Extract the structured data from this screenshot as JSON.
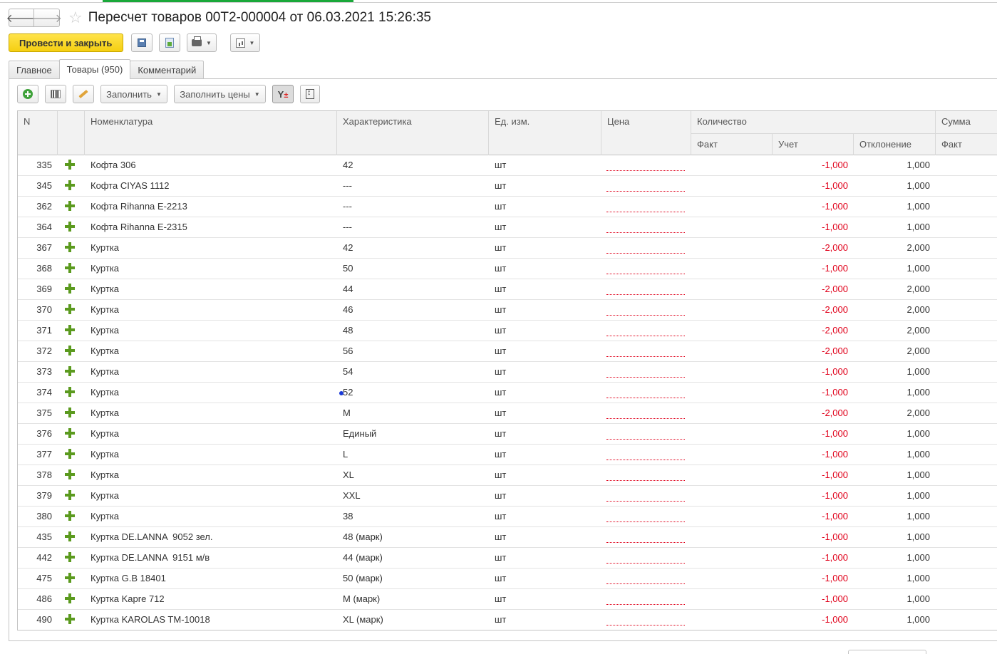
{
  "window": {
    "title": "Пересчет товаров 00Т2-000004 от 06.03.2021 15:26:35",
    "back_glyph": "🡐",
    "forward_glyph": "🡒",
    "star_glyph": "☆"
  },
  "toolbar": {
    "post_and_close": "Провести и закрыть",
    "save_icon": "floppy-icon",
    "post_icon": "document-post-icon",
    "print_icon": "printer-icon",
    "reports_icon": "report-icon"
  },
  "tabs": [
    {
      "label": "Главное",
      "active": false
    },
    {
      "label": "Товары (950)",
      "active": true
    },
    {
      "label": "Комментарий",
      "active": false
    }
  ],
  "grid_toolbar": {
    "fill_label": "Заполнить",
    "fill_prices_label": "Заполнить цены",
    "filter_glyph": "Y",
    "filter_sign": "±"
  },
  "columns": {
    "n": "N",
    "nomenclature": "Номенклатура",
    "characteristic": "Характеристика",
    "unit": "Ед. изм.",
    "price": "Цена",
    "quantity": "Количество",
    "quantity_fact": "Факт",
    "quantity_account": "Учет",
    "quantity_deviation": "Отклонение",
    "sum": "Сумма",
    "sum_fact": "Факт"
  },
  "rows": [
    {
      "n": "335",
      "name": "Кофта 306",
      "char": "42",
      "unit": "шт",
      "deviation": "-1,000",
      "account": "1,000"
    },
    {
      "n": "345",
      "name": "Кофта CIYAS 1112",
      "char": "---",
      "unit": "шт",
      "deviation": "-1,000",
      "account": "1,000"
    },
    {
      "n": "362",
      "name": "Кофта Rihanna E-2213",
      "char": "---",
      "unit": "шт",
      "deviation": "-1,000",
      "account": "1,000"
    },
    {
      "n": "364",
      "name": "Кофта Rihanna E-2315",
      "char": "---",
      "unit": "шт",
      "deviation": "-1,000",
      "account": "1,000"
    },
    {
      "n": "367",
      "name": "Куртка",
      "char": "42",
      "unit": "шт",
      "deviation": "-2,000",
      "account": "2,000"
    },
    {
      "n": "368",
      "name": "Куртка",
      "char": "50",
      "unit": "шт",
      "deviation": "-1,000",
      "account": "1,000"
    },
    {
      "n": "369",
      "name": "Куртка",
      "char": "44",
      "unit": "шт",
      "deviation": "-2,000",
      "account": "2,000"
    },
    {
      "n": "370",
      "name": "Куртка",
      "char": "46",
      "unit": "шт",
      "deviation": "-2,000",
      "account": "2,000"
    },
    {
      "n": "371",
      "name": "Куртка",
      "char": "48",
      "unit": "шт",
      "deviation": "-2,000",
      "account": "2,000"
    },
    {
      "n": "372",
      "name": "Куртка",
      "char": "56",
      "unit": "шт",
      "deviation": "-2,000",
      "account": "2,000"
    },
    {
      "n": "373",
      "name": "Куртка",
      "char": "54",
      "unit": "шт",
      "deviation": "-1,000",
      "account": "1,000"
    },
    {
      "n": "374",
      "name": "Куртка",
      "char": "52",
      "unit": "шт",
      "deviation": "-1,000",
      "account": "1,000"
    },
    {
      "n": "375",
      "name": "Куртка",
      "char": "M",
      "unit": "шт",
      "deviation": "-2,000",
      "account": "2,000"
    },
    {
      "n": "376",
      "name": "Куртка",
      "char": "Единый",
      "unit": "шт",
      "deviation": "-1,000",
      "account": "1,000"
    },
    {
      "n": "377",
      "name": "Куртка",
      "char": "L",
      "unit": "шт",
      "deviation": "-1,000",
      "account": "1,000"
    },
    {
      "n": "378",
      "name": "Куртка",
      "char": "XL",
      "unit": "шт",
      "deviation": "-1,000",
      "account": "1,000"
    },
    {
      "n": "379",
      "name": "Куртка",
      "char": "XXL",
      "unit": "шт",
      "deviation": "-1,000",
      "account": "1,000"
    },
    {
      "n": "380",
      "name": "Куртка",
      "char": "38",
      "unit": "шт",
      "deviation": "-1,000",
      "account": "1,000"
    },
    {
      "n": "435",
      "name": "Куртка DE.LANNA  9052 зел.",
      "char": "48 (марк)",
      "unit": "шт",
      "deviation": "-1,000",
      "account": "1,000"
    },
    {
      "n": "442",
      "name": "Куртка DE.LANNA  9151 м/в",
      "char": "44 (марк)",
      "unit": "шт",
      "deviation": "-1,000",
      "account": "1,000"
    },
    {
      "n": "475",
      "name": "Куртка G.B 18401",
      "char": "50 (марк)",
      "unit": "шт",
      "deviation": "-1,000",
      "account": "1,000"
    },
    {
      "n": "486",
      "name": "Куртка Kapre 712",
      "char": "M (марк)",
      "unit": "шт",
      "deviation": "-1,000",
      "account": "1,000"
    },
    {
      "n": "490",
      "name": "Куртка KAROLAS TM-10018",
      "char": "XL (марк)",
      "unit": "шт",
      "deviation": "-1,000",
      "account": "1,000"
    }
  ],
  "colors": {
    "accent_yellow": "#f5cf12",
    "negative_red": "#e0001a",
    "row_icon_green": "#5b9a1e",
    "top_strip_green": "#1aa83a"
  }
}
